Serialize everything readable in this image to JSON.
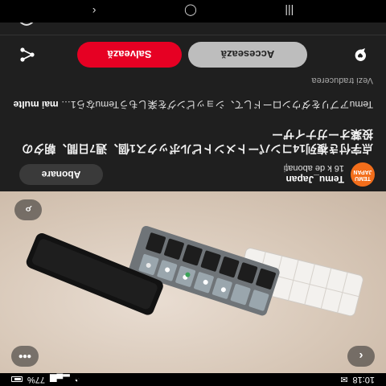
{
  "status_bar": {
    "time": "10:18",
    "battery": "77%"
  },
  "seller": {
    "avatar_text": "TEMU JAPAN",
    "name": "Temu_Japan",
    "subscribers": "16 k de abonați",
    "follow_label": "Abonare"
  },
  "pin": {
    "title": "点字付き複列14コンパートメントピルボックス1個、週7日間、朝夕の投薬オーガナイザー",
    "description": "Temuアプリをダウンロードして、ショッピングを楽しもうTemuなら1…",
    "more_label": "mai multe",
    "translate_label": "Vezi traducerea"
  },
  "actions": {
    "access_label": "Accesează",
    "save_label": "Salvează"
  },
  "colors": {
    "save": "#e60023",
    "access": "#bdbdbd",
    "avatar": "#f36e1b"
  }
}
